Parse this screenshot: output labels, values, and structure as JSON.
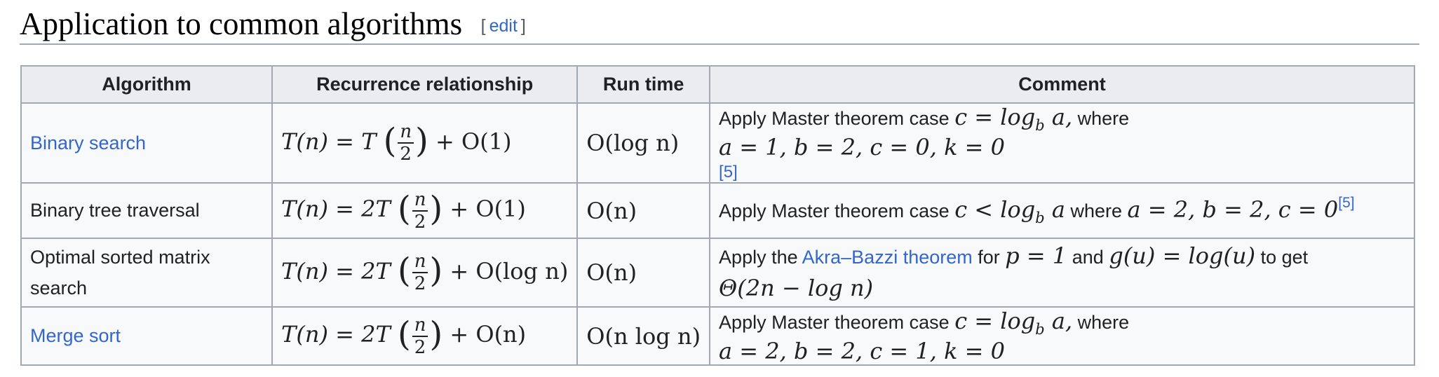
{
  "section": {
    "title": "Application to common algorithms",
    "edit_open": "[",
    "edit_label": "edit",
    "edit_close": "]"
  },
  "table": {
    "headers": [
      "Algorithm",
      "Recurrence relationship",
      "Run time",
      "Comment"
    ],
    "rows": [
      {
        "algorithm": "Binary search",
        "algorithm_is_link": true,
        "recurrence": {
          "lhs": "T(n) = T",
          "num": "n",
          "den": "2",
          "rhs": "+ O(1)"
        },
        "runtime": "O(log n)",
        "comment": {
          "text_a": "Apply Master theorem case ",
          "math_a": "c = log",
          "math_a_sub": "b",
          "math_a_end": " a,",
          "text_b": " where ",
          "math_b": "a = 1, b = 2, c = 0, k = 0",
          "ref": "[5]"
        }
      },
      {
        "algorithm": "Binary tree traversal",
        "algorithm_is_link": false,
        "recurrence": {
          "lhs": "T(n) = 2T",
          "num": "n",
          "den": "2",
          "rhs": "+ O(1)"
        },
        "runtime": "O(n)",
        "comment": {
          "text_a": "Apply Master theorem case ",
          "math_a": "c < log",
          "math_a_sub": "b",
          "math_a_end": " a",
          "text_b": " where ",
          "math_b": "a = 2, b = 2, c = 0",
          "ref": "[5]"
        }
      },
      {
        "algorithm": "Optimal sorted matrix search",
        "algorithm_is_link": false,
        "recurrence": {
          "lhs": "T(n) = 2T",
          "num": "n",
          "den": "2",
          "rhs": "+ O(log n)"
        },
        "runtime": "O(n)",
        "comment": {
          "text_a": "Apply the ",
          "link": "Akra–Bazzi theorem",
          "text_b": " for ",
          "math_a": "p = 1",
          "text_c": " and ",
          "math_b": "g(u) = log(u)",
          "text_d": " to get",
          "math_c": "Θ(2n − log n)"
        }
      },
      {
        "algorithm": "Merge sort",
        "algorithm_is_link": true,
        "recurrence": {
          "lhs": "T(n) = 2T",
          "num": "n",
          "den": "2",
          "rhs": "+ O(n)"
        },
        "runtime": "O(n log n)",
        "comment": {
          "text_a": "Apply Master theorem case ",
          "math_a": "c = log",
          "math_a_sub": "b",
          "math_a_end": " a,",
          "text_b": " where ",
          "math_b": "a = 2, b = 2, c = 1, k = 0"
        }
      }
    ]
  },
  "colors": {
    "link": "#3366cc",
    "header_bg": "#eaecf0",
    "cell_bg": "#f8f9fa",
    "border": "#a2a9b1"
  }
}
